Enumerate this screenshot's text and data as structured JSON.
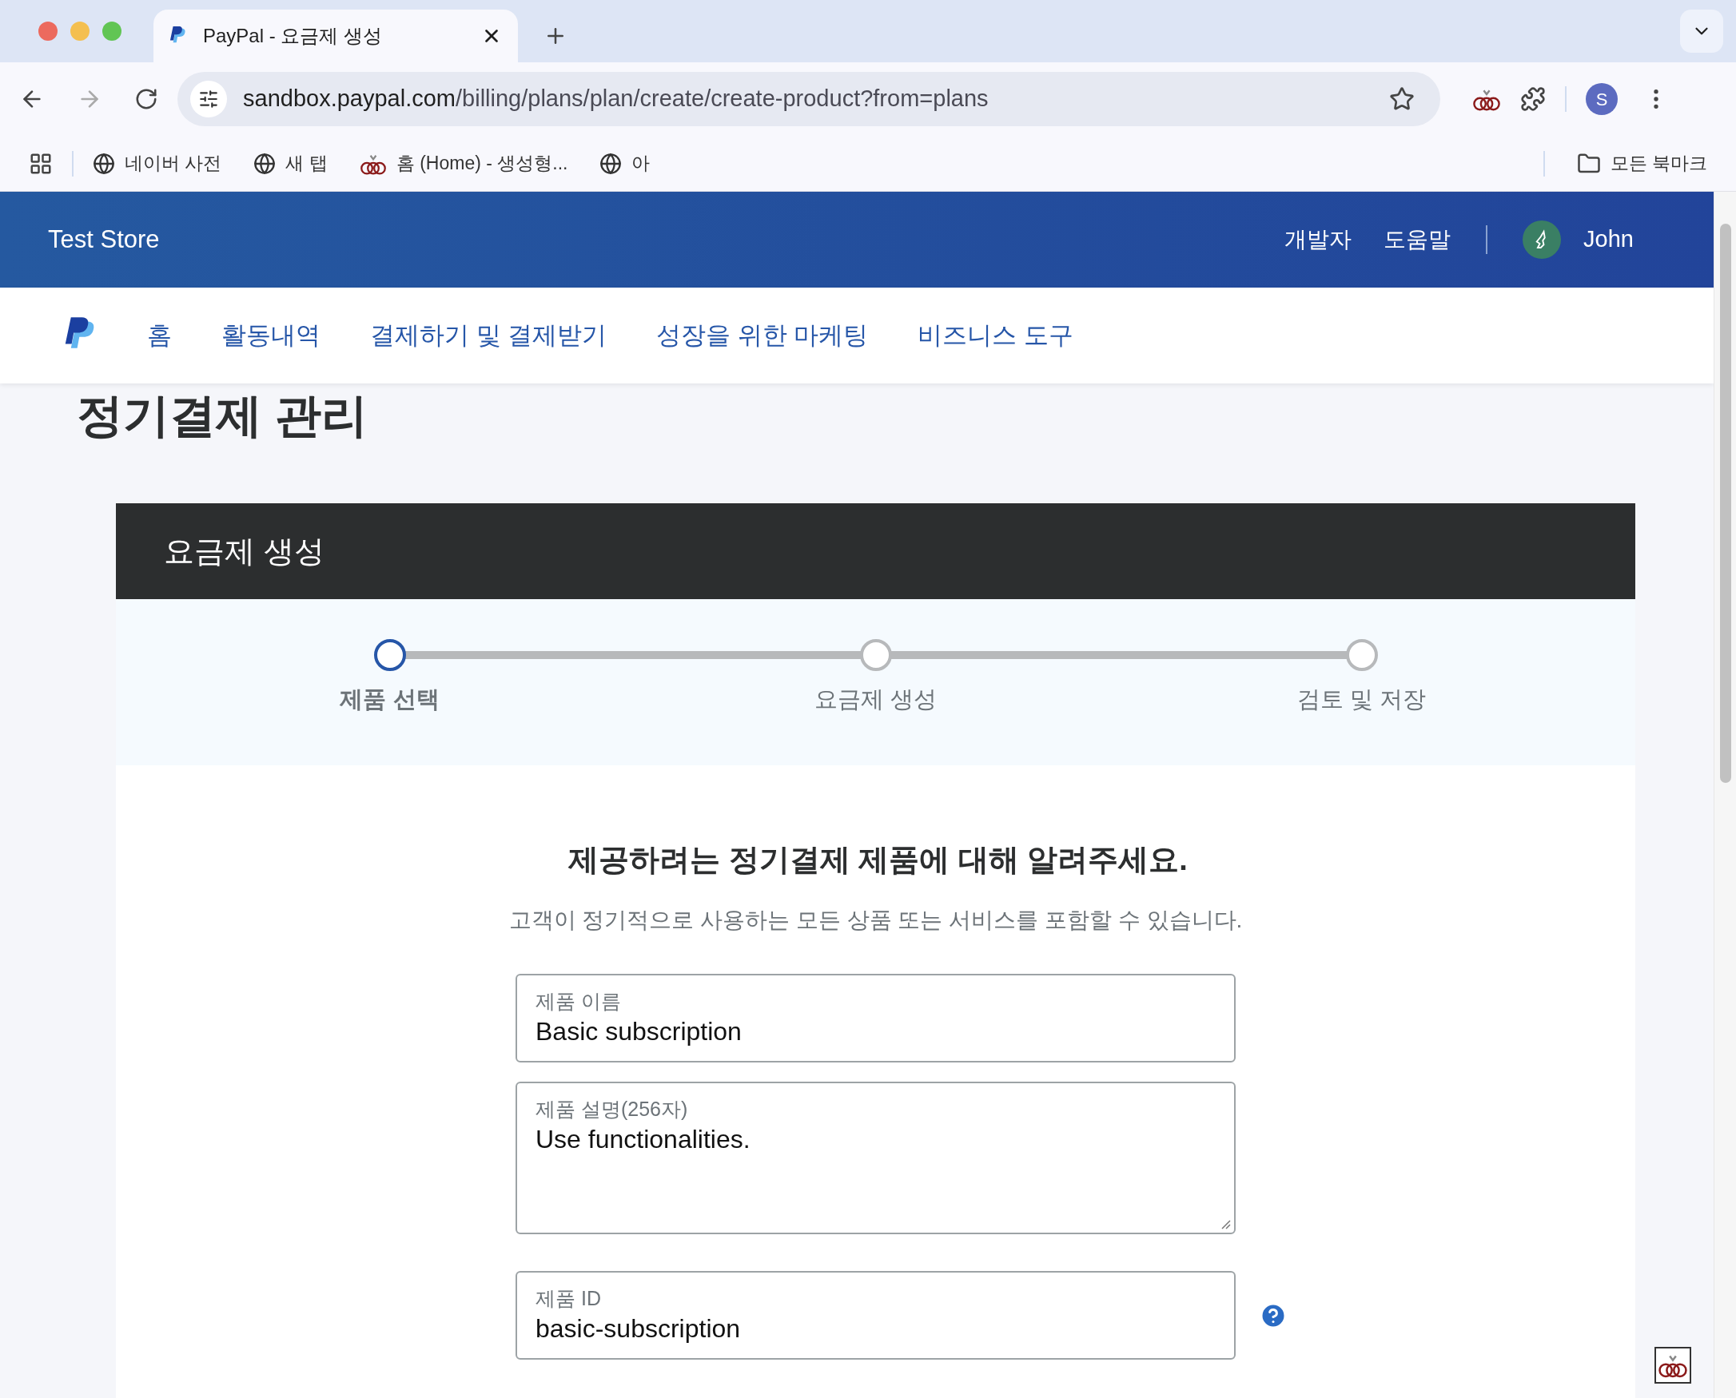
{
  "browser": {
    "tab_title": "PayPal - 요금제 생성",
    "url_host": "sandbox.paypal.com",
    "url_path": "/billing/plans/plan/create/create-product?from=plans",
    "profile_initial": "S",
    "bookmarks": [
      {
        "label": "네이버 사전",
        "kind": "globe"
      },
      {
        "label": "새 탭",
        "kind": "globe"
      },
      {
        "label": "홈 (Home) - 생성형...",
        "kind": "ext"
      },
      {
        "label": "아",
        "kind": "globe"
      }
    ],
    "all_bookmarks": "모든 북마크"
  },
  "header": {
    "store": "Test Store",
    "links": [
      "개발자",
      "도움말"
    ],
    "user": "John"
  },
  "nav": [
    "홈",
    "활동내역",
    "결제하기 및 결제받기",
    "성장을 위한 마케팅",
    "비즈니스 도구"
  ],
  "page_title": "정기결제 관리",
  "card": {
    "title": "요금제 생성",
    "steps": [
      {
        "label": "제품 선택",
        "selected": true
      },
      {
        "label": "요금제 생성",
        "selected": false
      },
      {
        "label": "검토 및 저장",
        "selected": false
      }
    ],
    "heading": "제공하려는 정기결제 제품에 대해 알려주세요.",
    "subtitle": "고객이 정기적으로 사용하는 모든 상품 또는 서비스를 포함할 수 있습니다.",
    "fields": [
      {
        "kind": "text",
        "label": "제품 이름",
        "value": "Basic subscription"
      },
      {
        "kind": "textarea",
        "label": "제품 설명(256자)",
        "value": "Use functionalities."
      },
      {
        "kind": "help",
        "label": "제품 ID",
        "value": "basic-subscription"
      }
    ]
  }
}
